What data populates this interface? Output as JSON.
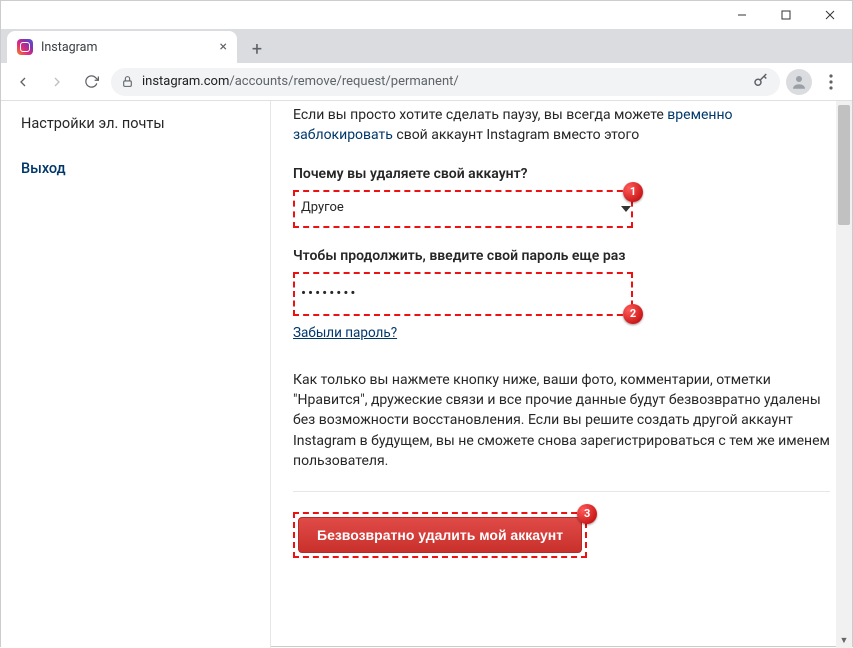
{
  "window": {
    "tab_title": "Instagram"
  },
  "address": {
    "host": "instagram.com",
    "path": "/accounts/remove/request/permanent/"
  },
  "sidebar": {
    "items": [
      {
        "label": "Настройки эл. почты"
      },
      {
        "label": "Выход"
      }
    ]
  },
  "intro": {
    "prefix": "Если вы просто хотите сделать паузу, вы всегда можете ",
    "link": "временно заблокировать",
    "suffix": " свой аккаунт Instagram вместо этого"
  },
  "reason": {
    "label": "Почему вы удаляете свой аккаунт?",
    "selected": "Другое",
    "badge": "1"
  },
  "password": {
    "label": "Чтобы продолжить, введите свой пароль еще раз",
    "masked": "••••••••",
    "badge": "2",
    "forgot": "Забыли пароль?"
  },
  "warning": "Как только вы нажмете кнопку ниже, ваши фото, комментарии, отметки \"Нравится\", дружеские связи и все прочие данные будут безвозвратно удалены без возможности восстановления. Если вы решите создать другой аккаунт Instagram в будущем, вы не сможете снова зарегистрироваться с тем же именем пользователя.",
  "delete": {
    "button": "Безвозвратно удалить мой аккаунт",
    "badge": "3"
  }
}
